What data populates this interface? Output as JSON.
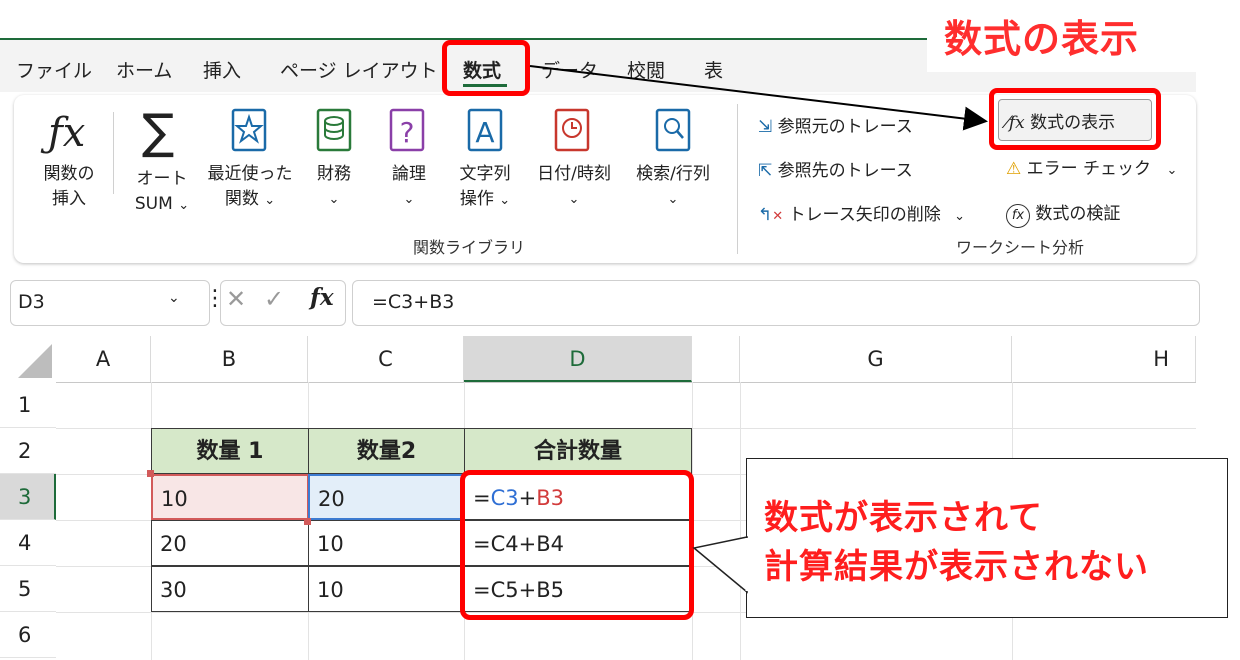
{
  "annotation": {
    "title_callout": "数式の表示",
    "message_line1": "数式が表示されて",
    "message_line2": "計算結果が表示されない"
  },
  "tabs": [
    "ファイル",
    "ホーム",
    "挿入",
    "ページ レイアウト",
    "数式",
    "データ",
    "校閲",
    "表"
  ],
  "active_tab": "数式",
  "ribbon": {
    "function_library": {
      "insert_function": {
        "line1": "関数の",
        "line2": "挿入",
        "icon": "fx-icon"
      },
      "autosum": {
        "line1": "オート",
        "line2": "SUM",
        "icon": "sigma-icon"
      },
      "recent": {
        "line1": "最近使った",
        "line2": "関数",
        "icon": "star-book-icon"
      },
      "financial": {
        "label": "財務",
        "icon": "coins-book-icon"
      },
      "logical": {
        "label": "論理",
        "icon": "question-book-icon"
      },
      "text": {
        "line1": "文字列",
        "line2": "操作",
        "icon": "letter-a-book-icon"
      },
      "datetime": {
        "label": "日付/時刻",
        "icon": "clock-book-icon"
      },
      "lookup": {
        "label": "検索/行列",
        "icon": "magnifier-book-icon"
      },
      "group_label": "関数ライブラリ"
    },
    "formula_auditing": {
      "trace_precedents": "参照元のトレース",
      "trace_dependents": "参照先のトレース",
      "remove_arrows": "トレース矢印の削除",
      "show_formulas": "数式の表示",
      "error_checking": "エラー チェック",
      "evaluate_formula": "数式の検証",
      "group_label": "ワークシート分析"
    }
  },
  "formula_bar": {
    "name_box": "D3",
    "fx_symbol": "fx",
    "value": "=C3+B3"
  },
  "sheet": {
    "columns": [
      "A",
      "B",
      "C",
      "D",
      "G",
      "H"
    ],
    "rows": [
      "1",
      "2",
      "3",
      "4",
      "5",
      "6"
    ],
    "header_row": [
      "数量 1",
      "数量2",
      "合計数量"
    ],
    "data": [
      {
        "b": "10",
        "c": "20",
        "d_eq": "=",
        "d_ref1": "C3",
        "d_plus": "+",
        "d_ref2": "B3"
      },
      {
        "b": "20",
        "c": "10",
        "d": "=C4+B4"
      },
      {
        "b": "30",
        "c": "10",
        "d": "=C5+B5"
      }
    ]
  },
  "colors": {
    "highlight_red": "#ff0000",
    "excel_green": "#1e6b3a",
    "header_fill": "#d6e8c9",
    "ref_blue": "#2f6fd4",
    "ref_red": "#d23b3b"
  }
}
